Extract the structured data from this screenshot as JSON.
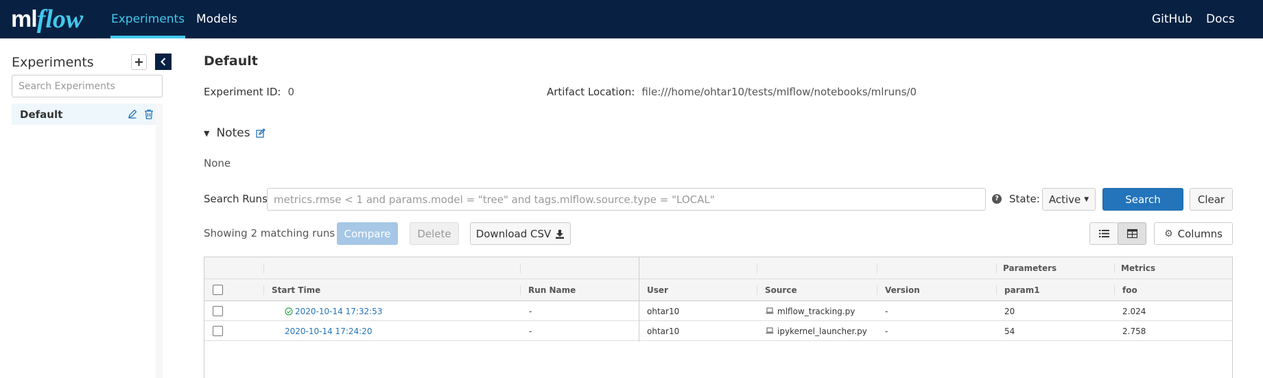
{
  "nav": {
    "logo_ml": "ml",
    "logo_flow": "flow",
    "experiments": "Experiments",
    "models": "Models",
    "github": "GitHub",
    "docs": "Docs"
  },
  "sidebar": {
    "title": "Experiments",
    "search_placeholder": "Search Experiments",
    "items": [
      {
        "label": "Default"
      }
    ]
  },
  "experiment": {
    "title": "Default",
    "id_label": "Experiment ID:",
    "id_value": "0",
    "artifact_label": "Artifact Location:",
    "artifact_value": "file:///home/ohtar10/tests/mlflow/notebooks/mlruns/0",
    "notes_label": "Notes",
    "notes_value": "None"
  },
  "search": {
    "label": "Search Runs:",
    "placeholder": "metrics.rmse < 1 and params.model = \"tree\" and tags.mlflow.source.type = \"LOCAL\"",
    "state_label": "State:",
    "state_value": "Active",
    "search_button": "Search",
    "clear_button": "Clear"
  },
  "toolbar": {
    "showing": "Showing 2 matching runs",
    "compare": "Compare",
    "delete": "Delete",
    "download": "Download CSV",
    "columns": "Columns"
  },
  "table": {
    "group_headers": {
      "params": "Parameters",
      "metrics": "Metrics"
    },
    "headers": {
      "start_time": "Start Time",
      "run_name": "Run Name",
      "user": "User",
      "source": "Source",
      "version": "Version",
      "param1": "param1",
      "foo": "foo"
    },
    "rows": [
      {
        "status": "finished",
        "start_time": "2020-10-14 17:32:53",
        "run_name": "-",
        "user": "ohtar10",
        "source": "mlflow_tracking.py",
        "version": "-",
        "param1": "20",
        "foo": "2.024"
      },
      {
        "status": "",
        "start_time": "2020-10-14 17:24:20",
        "run_name": "-",
        "user": "ohtar10",
        "source": "ipykernel_launcher.py",
        "version": "-",
        "param1": "54",
        "foo": "2.758"
      }
    ]
  },
  "colors": {
    "topbar": "#082142",
    "accent": "#43c9ed",
    "primary": "#2374bb",
    "success": "#2ea44f"
  }
}
